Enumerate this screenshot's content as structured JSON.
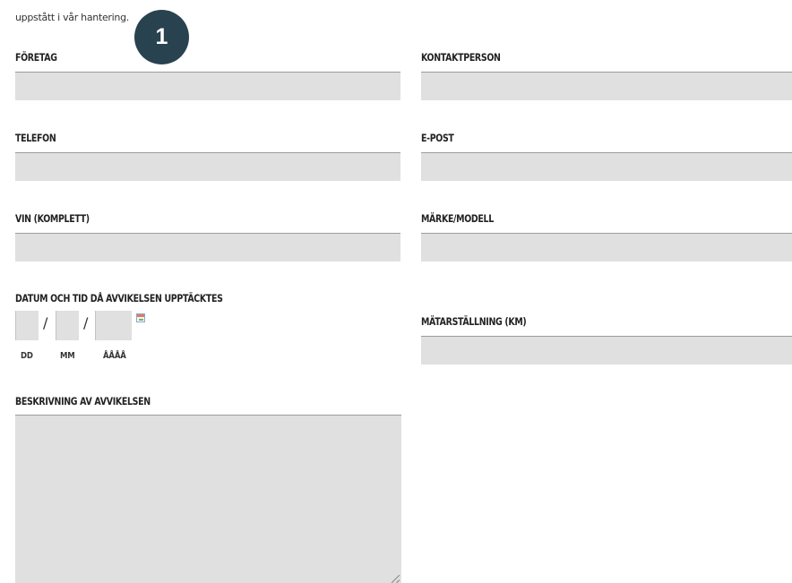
{
  "intro": {
    "text": "uppstått i vår hantering."
  },
  "step": {
    "number": "1",
    "color": "#29424f"
  },
  "fields": {
    "company": {
      "label": "FÖRETAG",
      "value": ""
    },
    "contact": {
      "label": "KONTAKTPERSON",
      "value": ""
    },
    "phone": {
      "label": "TELEFON",
      "value": ""
    },
    "email": {
      "label": "E-POST",
      "value": ""
    },
    "vin": {
      "label": "VIN (KOMPLETT)",
      "value": ""
    },
    "make_model": {
      "label": "MÄRKE/MODELL",
      "value": ""
    },
    "odometer": {
      "label": "MÄTARSTÄLLNING (KM)",
      "value": ""
    },
    "description": {
      "label": "BESKRIVNING AV AVVIKELSEN",
      "value": ""
    }
  },
  "date": {
    "label": "DATUM OCH TID DÅ AVVIKELSEN UPPTÄCKTES",
    "separator": "/",
    "day_label": "DD",
    "month_label": "MM",
    "year_label": "ÅÅÅÅ",
    "day_value": "",
    "month_value": "",
    "year_value": "",
    "picker_icon": "calendar-icon"
  },
  "colors": {
    "field_background": "#e0e0e0",
    "field_border": "#9c9c9c",
    "badge": "#29424f"
  }
}
